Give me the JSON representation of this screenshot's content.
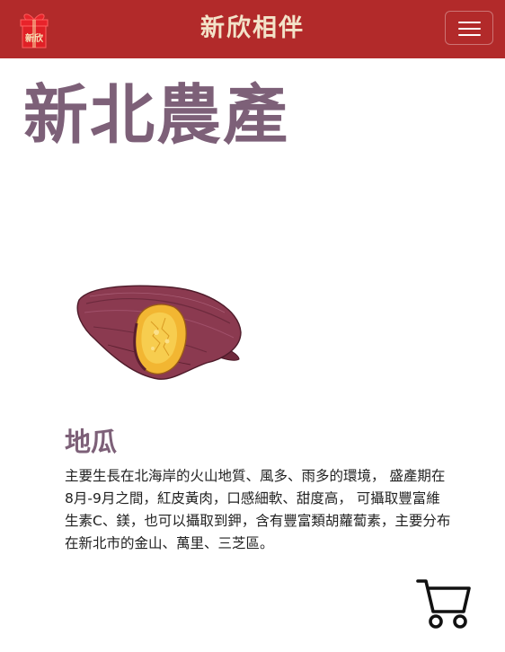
{
  "navbar": {
    "brand": "新欣相伴",
    "logo_icon": "gift-box-icon",
    "toggler_icon": "hamburger-menu-icon",
    "background_color": "#b22a2a",
    "brand_color": "#f3e3c9"
  },
  "page": {
    "title": "新北農產",
    "title_color": "#7d6078"
  },
  "product": {
    "image_icon": "sweet-potato-image",
    "name": "地瓜",
    "description": "主要生長在北海岸的火山地質、風多、雨多的環境， 盛產期在8月-9月之間，紅皮黃肉，口感細軟、甜度高， 可攝取豐富維生素C、鎂，也可以攝取到鉀，含有豐富類胡蘿蔔素，主要分布在新北市的金山、萬里、三芝區。"
  },
  "cart": {
    "icon": "shopping-cart-icon"
  }
}
